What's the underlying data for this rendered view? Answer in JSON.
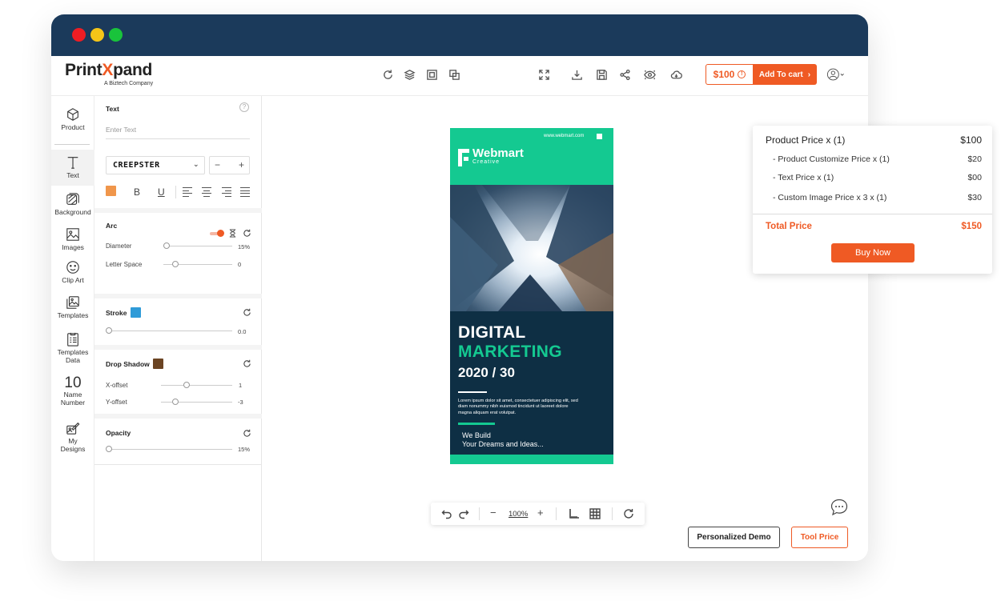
{
  "app": {
    "brand_prefix": "Print",
    "brand_x": "X",
    "brand_suffix": "pand",
    "brand_sub": "A Biztech Company"
  },
  "header": {
    "price_label": "$100",
    "add_to_cart_label": "Add To cart",
    "icons": [
      "refresh-icon",
      "layers-icon",
      "duplicate-icon",
      "arrange-icon",
      "fullscreen-icon",
      "download-icon",
      "save-icon",
      "share-icon",
      "preview-icon",
      "cloud-icon"
    ]
  },
  "sidebar": {
    "items": [
      {
        "label": "Product",
        "icon": "cube-icon"
      },
      {
        "label": "Text",
        "icon": "text-icon"
      },
      {
        "label": "Background",
        "icon": "background-icon"
      },
      {
        "label": "Images",
        "icon": "image-icon"
      },
      {
        "label": "Clip Art",
        "icon": "smiley-icon"
      },
      {
        "label": "Templates",
        "icon": "templates-icon"
      },
      {
        "label": "Templates Data",
        "icon": "templates-data-icon"
      },
      {
        "label": "Name Number",
        "icon": "number-icon",
        "glyph": "10"
      },
      {
        "label": "My Designs",
        "icon": "my-designs-icon"
      }
    ]
  },
  "text_panel": {
    "title": "Text",
    "help": "?",
    "input_placeholder": "Enter Text",
    "font": "CREEPSTER",
    "text_color": "#f0964b",
    "bold": "B",
    "underline": "U"
  },
  "arc": {
    "title": "Arc",
    "diameter_label": "Diameter",
    "diameter_value": "15%",
    "letter_space_label": "Letter Space",
    "letter_space_value": "0"
  },
  "stroke": {
    "title": "Stroke",
    "color": "#2f9bd8",
    "value": "0.0"
  },
  "drop_shadow": {
    "title": "Drop Shadow",
    "color": "#6b4423",
    "x_label": "X-offset",
    "x_value": "1",
    "y_label": "Y-offset",
    "y_value": "-3"
  },
  "opacity": {
    "title": "Opacity",
    "value": "15%"
  },
  "poster": {
    "url": "www.webmart.com",
    "brand": "Webmart",
    "brand_sub": "Creative",
    "line1": "DIGITAL",
    "line2": "MARKETING",
    "line3": "2020 / 30",
    "lorem": "Lorem ipsum dolor sit amet, consectetuer adipiscing elit, sed diam nonummy nibh euismod tincidunt ut laoreet dolore magna aliquam erat volutpat.",
    "cta_line1": "We Build",
    "cta_line2": "Your Dreams and Ideas...",
    "green": "#14c991",
    "navy": "#0e2f44"
  },
  "zoom": {
    "value": "100%"
  },
  "footer": {
    "demo_label": "Personalized Demo",
    "tool_price_label": "Tool Price"
  },
  "price_card": {
    "product_label": "Product Price  x  (1)",
    "product_value": "$100",
    "rows": [
      {
        "label": "- Product Customize Price  x  (1)",
        "value": "$20"
      },
      {
        "label": "- Text Price x (1)",
        "value": "$00"
      },
      {
        "label": "- Custom Image Price x 3 x  (1)",
        "value": "$30"
      }
    ],
    "total_label": "Total Price",
    "total_value": "$150",
    "buy_label": "Buy Now"
  },
  "accent": "#ef5a24"
}
